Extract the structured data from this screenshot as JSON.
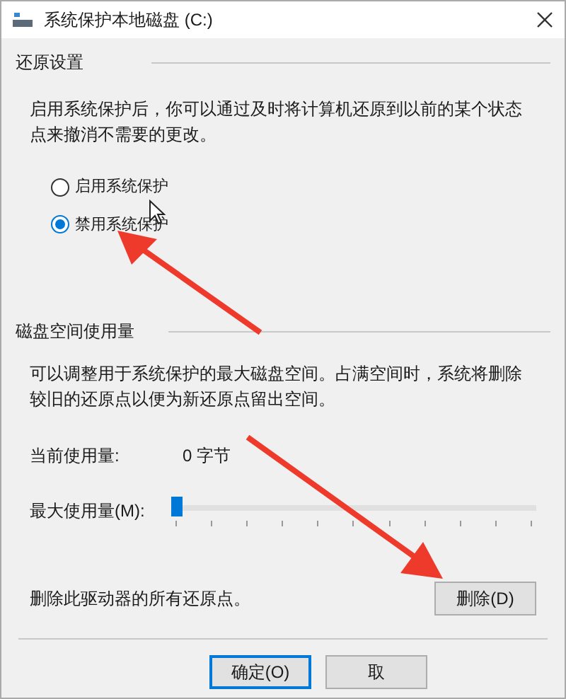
{
  "window": {
    "title": "系统保护本地磁盘 (C:)"
  },
  "restore_settings": {
    "heading": "还原设置",
    "description": "启用系统保护后，你可以通过及时将计算机还原到以前的某个状态点来撤消不需要的更改。",
    "options": [
      {
        "label": "启用系统保护",
        "selected": false
      },
      {
        "label": "禁用系统保护",
        "selected": true
      }
    ]
  },
  "disk_usage": {
    "heading": "磁盘空间使用量",
    "description": "可以调整用于系统保护的最大磁盘空间。占满空间时，系统将删除较旧的还原点以便为新还原点留出空间。",
    "current_label": "当前使用量:",
    "current_value": "0 字节",
    "max_label": "最大使用量(M):",
    "max_slider": {
      "level": 0
    },
    "delete_text": "删除此驱动器的所有还原点。",
    "delete_button": "删除(D)"
  },
  "buttons": [
    {
      "label": "确定(O)",
      "selected": true
    },
    {
      "label": "取",
      "selected": false
    }
  ]
}
